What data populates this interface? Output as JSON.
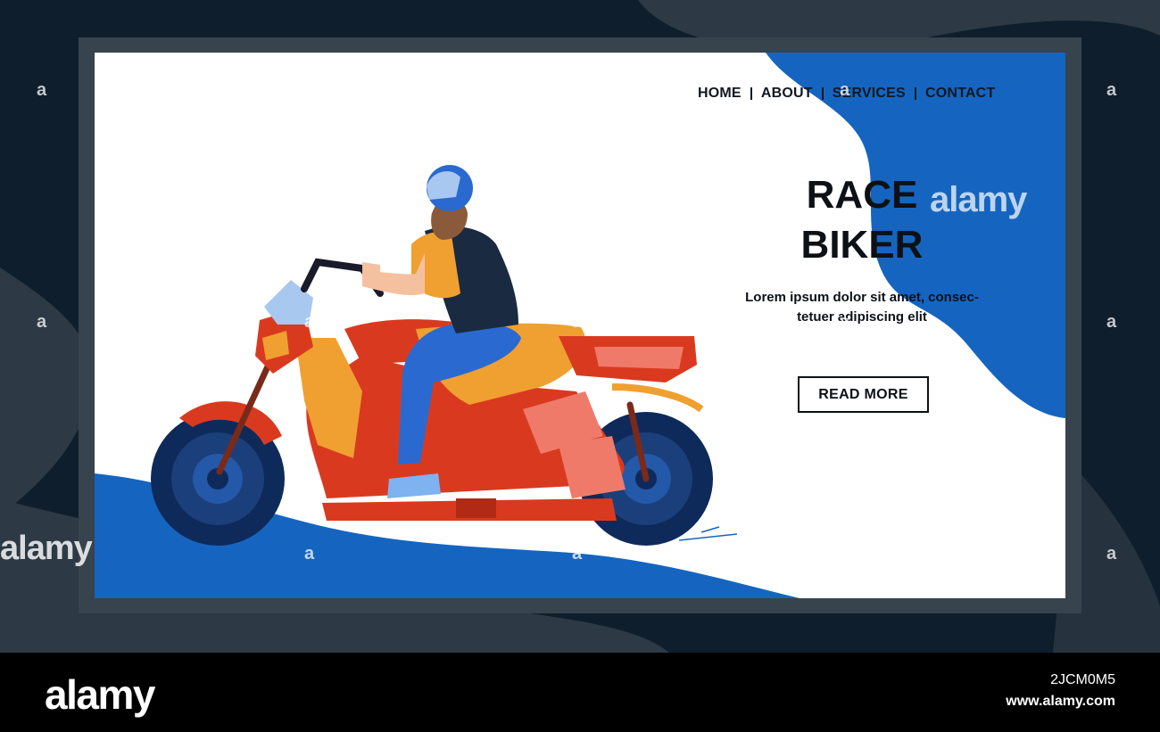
{
  "nav": {
    "items": [
      {
        "label": "HOME"
      },
      {
        "label": "ABOUT"
      },
      {
        "label": "SERVICES"
      },
      {
        "label": "CONTACT"
      }
    ]
  },
  "hero": {
    "title_line1": "RACE",
    "title_line2": "BIKER",
    "subtitle_line1": "Lorem ipsum dolor sit amet, consec-",
    "subtitle_line2": "tetuer adipiscing elit",
    "cta_label": "READ MORE"
  },
  "watermark": {
    "brand": "alamy",
    "mark": "a"
  },
  "footer": {
    "logo": "alamy",
    "image_id": "2JCM0M5",
    "url": "www.alamy.com"
  },
  "colors": {
    "accent_blue": "#1565c0",
    "frame_dark": "#0f1e2c",
    "frame_gray": "#2d3a45",
    "bike_red": "#d93a1f",
    "bike_orange": "#f0a030"
  }
}
